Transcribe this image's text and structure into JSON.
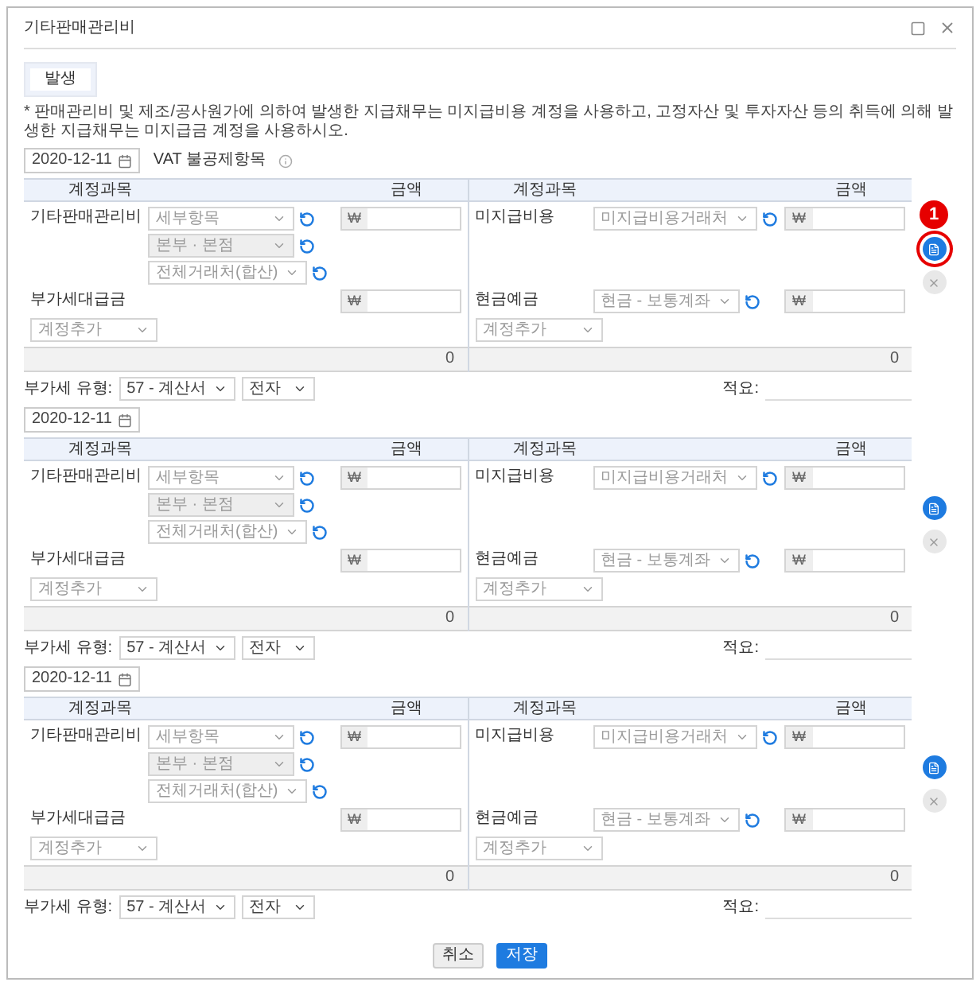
{
  "window": {
    "title": "기타판매관리비"
  },
  "tabs": [
    {
      "label": "발생",
      "selected": true
    }
  ],
  "notice": "* 판매관리비 및 제조/공사원가에 의하여 발생한 지급채무는 미지급비용 계정을 사용하고, 고정자산 및 투자자산 등의 취득에 의해 발생한 지급채무는 미지급금 계정을 사용하시오.",
  "entries": [
    {
      "date": "2020-12-11",
      "vat_label": "VAT 불공제항목",
      "highlighted": true,
      "annotation": "1",
      "sides": [
        {
          "header": {
            "account": "계정과목",
            "amount": "금액"
          },
          "accounts": [
            {
              "name": "기타판매관리비",
              "selects": [
                {
                  "text": "세부항목",
                  "disabled": false
                },
                {
                  "text": "본부 · 본점",
                  "disabled": true
                },
                {
                  "text": "전체거래처(합산)",
                  "disabled": false
                }
              ],
              "currency": "₩"
            },
            {
              "name": "부가세대급금",
              "currency": "₩"
            }
          ],
          "add": "계정추가",
          "total": "0"
        },
        {
          "header": {
            "account": "계정과목",
            "amount": "금액"
          },
          "accounts": [
            {
              "name": "미지급비용",
              "selects": [
                {
                  "text": "미지급비용거래처",
                  "disabled": false
                }
              ],
              "currency": "₩"
            },
            {
              "name": "현금예금",
              "selects": [
                {
                  "text": "현금 - 보통계좌",
                  "disabled": false
                }
              ],
              "currency": "₩"
            }
          ],
          "add": "계정추가",
          "total": "0"
        }
      ],
      "vat_type_label": "부가세 유형:",
      "vat_type": "57 - 계산서",
      "vat_kind": "전자",
      "memo_label": "적요:"
    },
    {
      "date": "2020-12-11",
      "highlighted": false,
      "sides": [
        {
          "header": {
            "account": "계정과목",
            "amount": "금액"
          },
          "accounts": [
            {
              "name": "기타판매관리비",
              "selects": [
                {
                  "text": "세부항목",
                  "disabled": false
                },
                {
                  "text": "본부 · 본점",
                  "disabled": true
                },
                {
                  "text": "전체거래처(합산)",
                  "disabled": false
                }
              ],
              "currency": "₩"
            },
            {
              "name": "부가세대급금",
              "currency": "₩"
            }
          ],
          "add": "계정추가",
          "total": "0"
        },
        {
          "header": {
            "account": "계정과목",
            "amount": "금액"
          },
          "accounts": [
            {
              "name": "미지급비용",
              "selects": [
                {
                  "text": "미지급비용거래처",
                  "disabled": false
                }
              ],
              "currency": "₩"
            },
            {
              "name": "현금예금",
              "selects": [
                {
                  "text": "현금 - 보통계좌",
                  "disabled": false
                }
              ],
              "currency": "₩"
            }
          ],
          "add": "계정추가",
          "total": "0"
        }
      ],
      "vat_type_label": "부가세 유형:",
      "vat_type": "57 - 계산서",
      "vat_kind": "전자",
      "memo_label": "적요:"
    },
    {
      "date": "2020-12-11",
      "highlighted": false,
      "sides": [
        {
          "header": {
            "account": "계정과목",
            "amount": "금액"
          },
          "accounts": [
            {
              "name": "기타판매관리비",
              "selects": [
                {
                  "text": "세부항목",
                  "disabled": false
                },
                {
                  "text": "본부 · 본점",
                  "disabled": true
                },
                {
                  "text": "전체거래처(합산)",
                  "disabled": false
                }
              ],
              "currency": "₩"
            },
            {
              "name": "부가세대급금",
              "currency": "₩"
            }
          ],
          "add": "계정추가",
          "total": "0"
        },
        {
          "header": {
            "account": "계정과목",
            "amount": "금액"
          },
          "accounts": [
            {
              "name": "미지급비용",
              "selects": [
                {
                  "text": "미지급비용거래처",
                  "disabled": false
                }
              ],
              "currency": "₩"
            },
            {
              "name": "현금예금",
              "selects": [
                {
                  "text": "현금 - 보통계좌",
                  "disabled": false
                }
              ],
              "currency": "₩"
            }
          ],
          "add": "계정추가",
          "total": "0"
        }
      ],
      "vat_type_label": "부가세 유형:",
      "vat_type": "57 - 계산서",
      "vat_kind": "전자",
      "memo_label": "적요:"
    }
  ],
  "buttons": [
    {
      "label": "취소",
      "kind": "secondary"
    },
    {
      "label": "저장",
      "kind": "primary"
    }
  ]
}
